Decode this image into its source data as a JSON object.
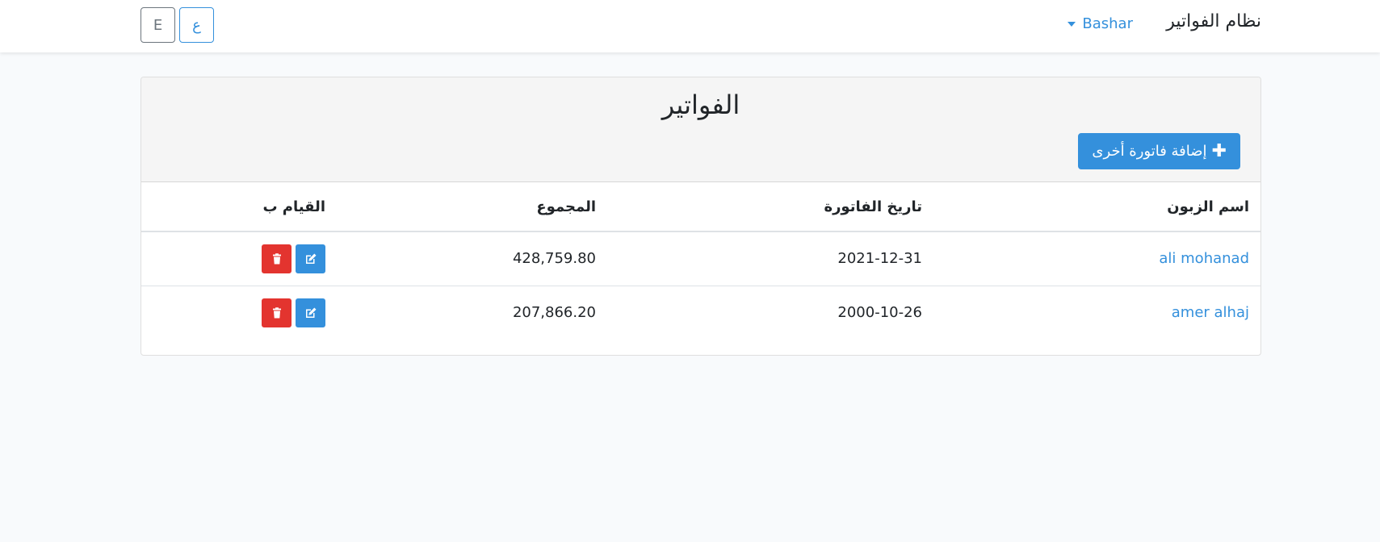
{
  "navbar": {
    "brand": "نظام الفواتير",
    "user_name": "Bashar",
    "lang_en_label": "E",
    "lang_ar_label": "ع"
  },
  "card": {
    "title": "الفواتير",
    "add_button_label": "إضافة فاتورة أخرى"
  },
  "table": {
    "headers": {
      "customer_name": "اسم الزبون",
      "invoice_date": "تاريخ الفاتورة",
      "total": "المجموع",
      "actions": "القيام ب"
    },
    "rows": [
      {
        "customer_name": "ali mohanad",
        "invoice_date": "2021-12-31",
        "total": "428,759.80"
      },
      {
        "customer_name": "amer alhaj",
        "invoice_date": "2000-10-26",
        "total": "207,866.20"
      }
    ]
  },
  "icons": {
    "edit": "edit-icon",
    "delete": "trash-icon",
    "add": "plus-icon",
    "dropdown": "caret-down-icon"
  },
  "colors": {
    "primary": "#3490dc",
    "danger": "#e3342f",
    "background": "#f8fafc"
  }
}
